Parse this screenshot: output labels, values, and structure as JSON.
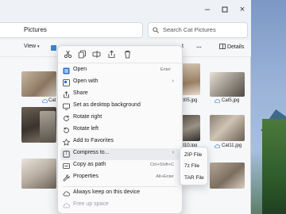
{
  "window": {
    "path_label": "Pictures",
    "search_placeholder": "Search Cat Pictures",
    "controls": [
      "minimize",
      "maximize",
      "close"
    ]
  },
  "command_bar": {
    "view_label": "View",
    "more_label": "…",
    "details_label": "Details",
    "sort_partial": "t"
  },
  "files": {
    "labels": [
      "Cat",
      "at05.jpg",
      "Cat5.jpg",
      "at10.jpg",
      "Cat11.jpg"
    ]
  },
  "context_menu": {
    "quick_actions": [
      "cut-icon",
      "copy-icon",
      "rename-icon",
      "share-icon",
      "delete-icon"
    ],
    "items": [
      {
        "icon": "open-icon",
        "label": "Open",
        "shortcut": "Enter"
      },
      {
        "icon": "open-with-icon",
        "label": "Open with",
        "submenu": true
      },
      {
        "icon": "share-icon",
        "label": "Share"
      },
      {
        "icon": "desktop-icon",
        "label": "Set as desktop background"
      },
      {
        "icon": "rotate-right-icon",
        "label": "Rotate right"
      },
      {
        "icon": "rotate-left-icon",
        "label": "Rotate left"
      },
      {
        "icon": "star-icon",
        "label": "Add to Favorites"
      },
      {
        "icon": "compress-icon",
        "label": "Compress to...",
        "submenu": true,
        "highlighted": true
      },
      {
        "icon": "copy-path-icon",
        "label": "Copy as path",
        "shortcut": "Ctrl+Shift+C"
      },
      {
        "icon": "properties-icon",
        "label": "Properties",
        "shortcut": "Alt+Enter"
      },
      {
        "icon": "cloud-keep-icon",
        "label": "Always keep on this device"
      },
      {
        "icon": "cloud-free-icon",
        "label": "Free up space",
        "disabled": true
      }
    ]
  },
  "compress_submenu": {
    "items": [
      "ZIP File",
      "7z File",
      "TAR File"
    ]
  },
  "colors": {
    "highlight": "#e9ebef",
    "accent": "#0067c0"
  }
}
